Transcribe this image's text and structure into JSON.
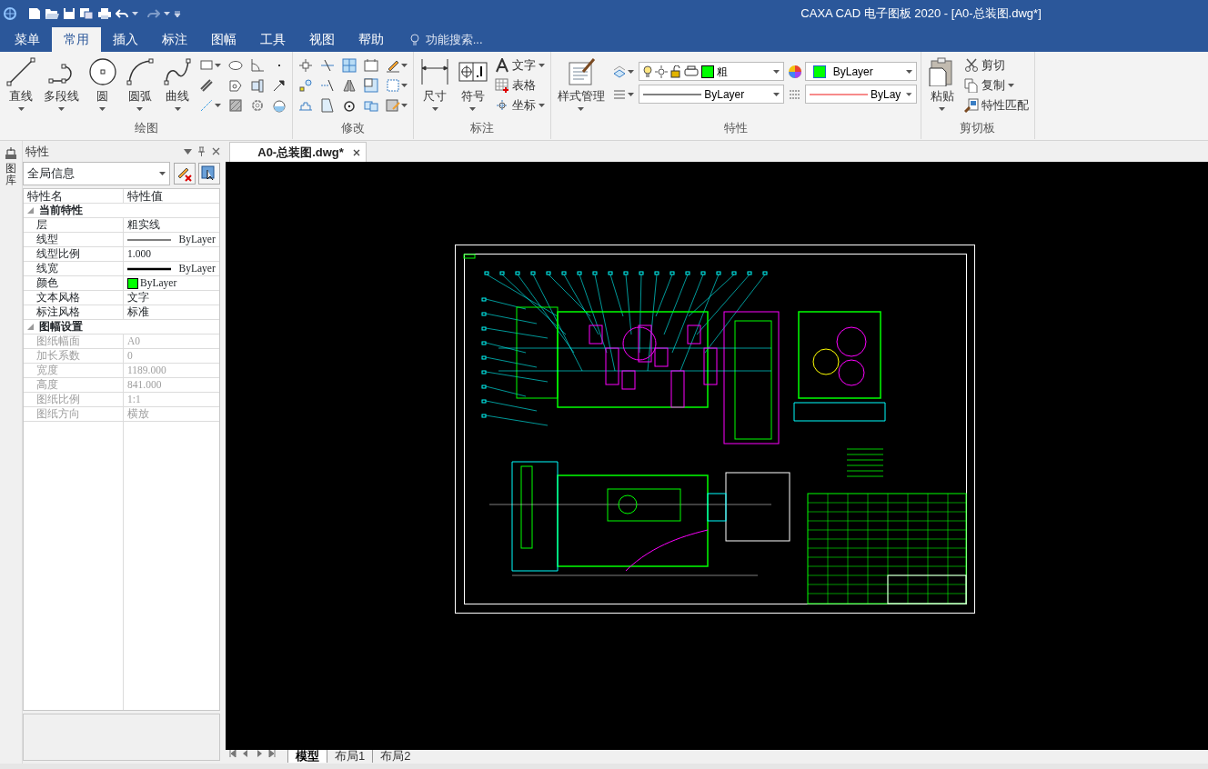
{
  "window": {
    "title": "CAXA CAD 电子图板 2020 - [A0-总装图.dwg*]"
  },
  "ribbon_tabs": [
    {
      "label": "菜单",
      "selected": false
    },
    {
      "label": "常用",
      "selected": true
    },
    {
      "label": "插入",
      "selected": false
    },
    {
      "label": "标注",
      "selected": false
    },
    {
      "label": "图幅",
      "selected": false
    },
    {
      "label": "工具",
      "selected": false
    },
    {
      "label": "视图",
      "selected": false
    },
    {
      "label": "帮助",
      "selected": false
    }
  ],
  "search": {
    "placeholder": "功能搜索..."
  },
  "ribbon_groups": [
    {
      "kind": "draw",
      "title": "绘图",
      "large_buttons": [
        "直线",
        "多段线",
        "圆",
        "圆弧",
        "曲线"
      ]
    },
    {
      "kind": "modify",
      "title": "修改"
    },
    {
      "kind": "annotate",
      "title": "标注",
      "large_buttons": [
        "尺寸",
        "符号"
      ],
      "small_buttons": [
        {
          "label": "文字",
          "dropdown": true
        },
        {
          "label": "表格",
          "dropdown": false
        },
        {
          "label": "坐标",
          "dropdown": true
        }
      ]
    },
    {
      "kind": "properties",
      "title": "特性",
      "large_buttons": [
        "样式管理"
      ],
      "layer_combo": "粗",
      "color_combo": "ByLayer",
      "linetype_combo": "ByLayer",
      "lineweight_combo": "ByLay"
    },
    {
      "kind": "clipboard",
      "title": "剪切板",
      "large_buttons": [
        "粘贴"
      ],
      "small_buttons": [
        {
          "label": "剪切",
          "dropdown": false
        },
        {
          "label": "复制",
          "dropdown": true
        },
        {
          "label": "特性匹配",
          "dropdown": false
        }
      ]
    }
  ],
  "side_strip": {
    "label": "图库"
  },
  "properties": {
    "title": "特性",
    "selector": "全局信息",
    "columns": [
      "特性名",
      "特性值"
    ],
    "sections": [
      {
        "title": "当前特性",
        "expanded": true,
        "rows": [
          {
            "name": "层",
            "value": "粗实线",
            "kind": "text",
            "disabled": false
          },
          {
            "name": "线型",
            "value": "ByLayer",
            "kind": "line",
            "disabled": false
          },
          {
            "name": "线型比例",
            "value": "1.000",
            "kind": "text",
            "disabled": false
          },
          {
            "name": "线宽",
            "value": "ByLayer",
            "kind": "thick_line",
            "disabled": false
          },
          {
            "name": "颜色",
            "value": "ByLayer",
            "kind": "swatch",
            "disabled": false
          },
          {
            "name": "文本风格",
            "value": "文字",
            "kind": "text",
            "disabled": false
          },
          {
            "name": "标注风格",
            "value": "标准",
            "kind": "text",
            "disabled": false
          }
        ]
      },
      {
        "title": "图幅设置",
        "expanded": true,
        "rows": [
          {
            "name": "图纸幅面",
            "value": "A0",
            "kind": "text",
            "disabled": true
          },
          {
            "name": "加长系数",
            "value": "0",
            "kind": "text",
            "disabled": true
          },
          {
            "name": "宽度",
            "value": "1189.000",
            "kind": "text",
            "disabled": true
          },
          {
            "name": "高度",
            "value": "841.000",
            "kind": "text",
            "disabled": true
          },
          {
            "name": "图纸比例",
            "value": "1:1",
            "kind": "text",
            "disabled": true
          },
          {
            "name": "图纸方向",
            "value": "横放",
            "kind": "text",
            "disabled": true
          }
        ]
      }
    ]
  },
  "document_tab": {
    "label": "A0-总装图.dwg*"
  },
  "layout_tabs": [
    {
      "label": "模型",
      "selected": true
    },
    {
      "label": "布局1",
      "selected": false
    },
    {
      "label": "布局2",
      "selected": false
    }
  ]
}
